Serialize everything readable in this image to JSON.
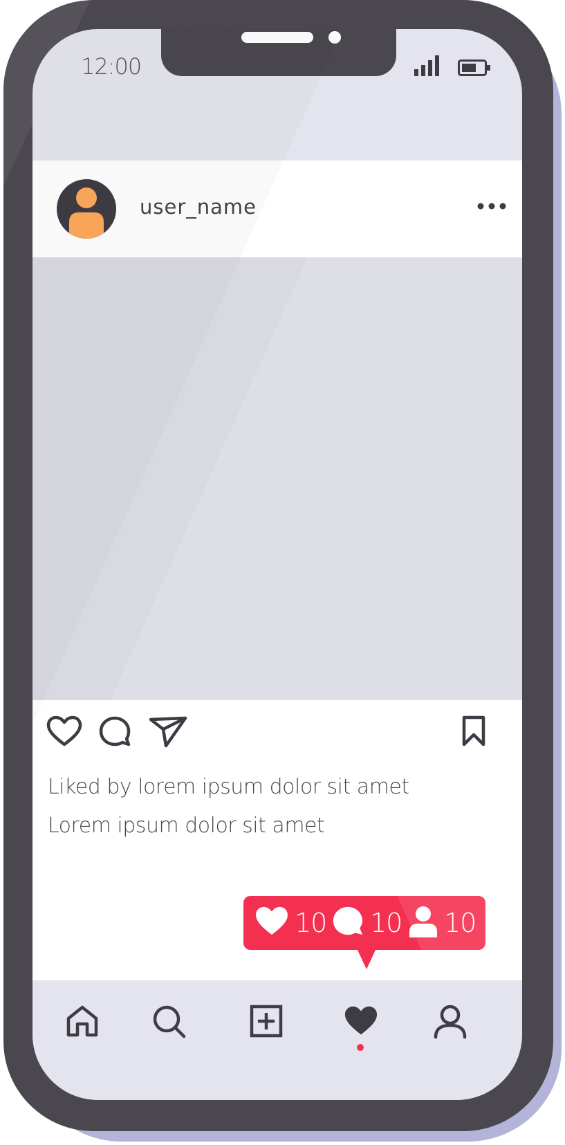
{
  "status_bar": {
    "time": "12:00",
    "icons": [
      "signal-icon",
      "battery-icon"
    ]
  },
  "post": {
    "username": "user_name",
    "header_icons": [
      "avatar-icon",
      "more-options-icon"
    ],
    "actions": [
      "heart-icon",
      "comment-icon",
      "share-icon",
      "bookmark-icon"
    ],
    "liked_by": "Liked by lorem ipsum dolor sit amet",
    "caption": "Lorem ipsum dolor sit amet"
  },
  "notification": {
    "likes": "10",
    "comments": "10",
    "followers": "10",
    "icons": [
      "heart-icon",
      "comment-icon",
      "user-icon"
    ]
  },
  "tab_bar": {
    "items": [
      "home-icon",
      "search-icon",
      "add-post-icon",
      "activity-heart-icon",
      "profile-icon"
    ],
    "active": "activity-heart-icon"
  },
  "colors": {
    "frame": "#4b474f",
    "screen": "#e4e4ee",
    "accent": "#f43051",
    "avatar_person": "#fea95c",
    "icon": "#3f3b44",
    "frame_shadow": "#b3b4d8"
  }
}
